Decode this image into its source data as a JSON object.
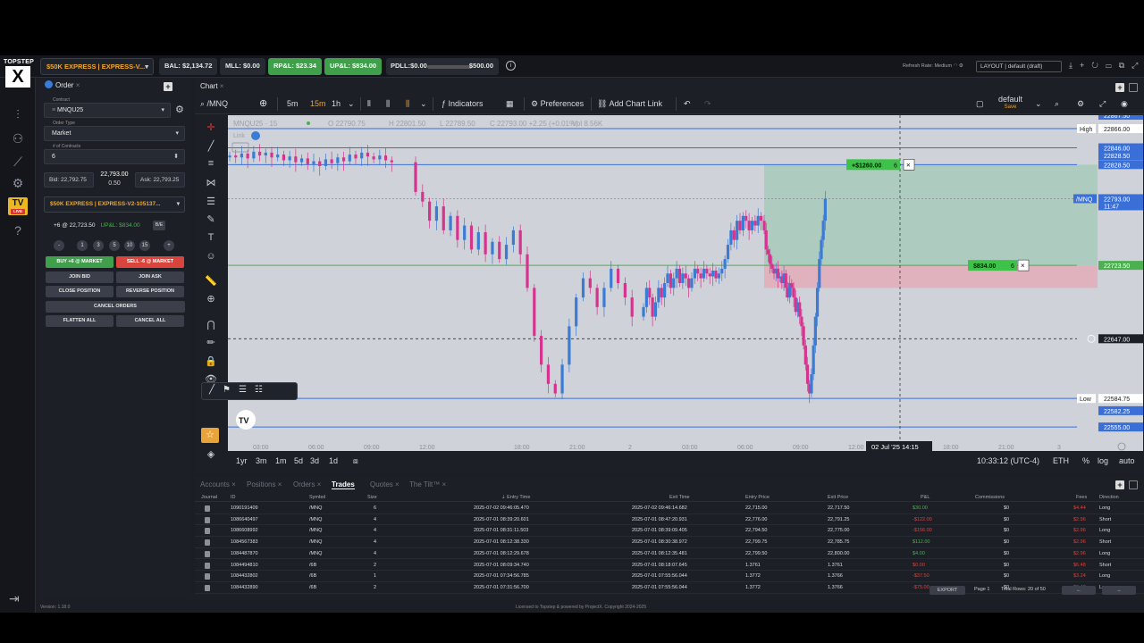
{
  "topbar": {
    "logo_top": "TOPSTEP",
    "logo_x": "X",
    "account": "$50K EXPRESS | EXPRESS-V...",
    "balance": "BAL: $2,134.72",
    "mll": "MLL: $0.00",
    "rpl": "RP&L: $23.34",
    "upl": "UP&L: $834.00",
    "pdll": "PDLL:$0.00",
    "pdll_max": "$500.00",
    "refresh_rate": "Refresh Rate: Medium",
    "layout": "LAYOUT | default (draft)"
  },
  "order_panel": {
    "tab_label": "Order",
    "contract_label": "Contract",
    "contract": "MNQU25",
    "order_type_label": "Order Type",
    "order_type": "Market",
    "contracts_label": "# of Contracts",
    "contracts": "6",
    "bid": "Bid: 22,792.75",
    "mid_price": "22,793.00",
    "spread": "0.50",
    "ask": "Ask: 22,793.25",
    "account": "$50K EXPRESS | EXPRESS-V2-105137...",
    "position": "+6 @ 22,723.50",
    "position_upl": "UP&L: $834.00",
    "be_label": "B/E",
    "qty_buttons": [
      "-",
      "1",
      "3",
      "5",
      "10",
      "15",
      "+"
    ],
    "buy_label": "BUY +6 @ MARKET",
    "sell_label": "SELL -6 @ MARKET",
    "join_bid": "JOIN BID",
    "join_ask": "JOIN ASK",
    "close_position": "CLOSE POSITION",
    "reverse_position": "REVERSE POSITION",
    "cancel_orders": "CANCEL ORDERS",
    "flatten_all": "FLATTEN ALL",
    "cancel_all": "CANCEL ALL"
  },
  "chart": {
    "tab_label": "Chart",
    "symbol": "/MNQ",
    "timeframes": [
      "5m",
      "15m",
      "1h"
    ],
    "active_timeframe": "15m",
    "indicators": "Indicators",
    "preferences": "Preferences",
    "add_chart_link": "Add Chart Link",
    "layout_name": "default",
    "layout_save": "Save",
    "legend_title": "MNQU25 · 15",
    "legend_o": "O 22790.75",
    "legend_h": "H 22801.50",
    "legend_l": "L 22789.50",
    "legend_c": "C 22793.00 +2.25 (+0.01%)",
    "legend_vol": "Vol 8.56K",
    "link_label": "Link",
    "tv_logo": "TV",
    "ranges": [
      "1yr",
      "3m",
      "1m",
      "5d",
      "3d",
      "1d"
    ],
    "clock": "10:33:12 (UTC-4)",
    "session": "ETH",
    "pct": "%",
    "log": "log",
    "auto": "auto",
    "crosshair_time": "02 Jul '25   14:15",
    "profit_tag": "+$1260.00",
    "profit_qty": "6",
    "position_tag": "$834.00",
    "position_qty": "6",
    "price_labels": {
      "p1": "22867.50",
      "high_tag": "High",
      "high": "22866.00",
      "p2": "22846.00",
      "p3": "22828.50",
      "p4": "22828.50",
      "last_symbol": "/MNQ",
      "last": "22793.00",
      "countdown": "11:47",
      "entry": "22723.50",
      "crosshair": "22647.00",
      "low_tag": "Low",
      "low": "22584.75",
      "p5": "22582.25",
      "p6": "22555.00"
    },
    "x_ticks": [
      "03:00",
      "06:00",
      "09:00",
      "12:00",
      "18:00",
      "21:00",
      "2",
      "03:00",
      "06:00",
      "09:00",
      "12:00",
      "18:00",
      "21:00",
      "3"
    ]
  },
  "chart_data": {
    "type": "candlestick",
    "symbol": "MNQU25",
    "interval": "15m",
    "ylim": [
      22530,
      22880
    ],
    "closes": [
      22838,
      22836,
      22840,
      22835,
      22842,
      22838,
      22841,
      22836,
      22839,
      22833,
      22837,
      22831,
      22835,
      22829,
      22832,
      22827,
      22834,
      22830,
      22836,
      22832,
      22839,
      22835,
      22841,
      22837,
      22834,
      22838,
      22833,
      22831,
      22800,
      22790,
      22770,
      22785,
      22760,
      22775,
      22750,
      22765,
      22740,
      22758,
      22735,
      22748,
      22730,
      22745,
      22760,
      22735,
      22700,
      22650,
      22620,
      22600,
      22590,
      22620,
      22660,
      22690,
      22710,
      22700,
      22680,
      22700,
      22720,
      22705,
      22690,
      22670,
      22680,
      22700,
      22690,
      22670,
      22685,
      22700,
      22690,
      22705,
      22715,
      22700,
      22710,
      22720,
      22705,
      22715,
      22710,
      22700,
      22710,
      22720,
      22715,
      22710,
      22720,
      22715,
      22712,
      22718,
      22710,
      22715,
      22720,
      22730,
      22745,
      22760,
      22750,
      22770,
      22760,
      22775,
      22770,
      22760,
      22770,
      22765,
      22775,
      22770,
      22760,
      22740,
      22735,
      22725,
      22720,
      22715,
      22720,
      22710,
      22712,
      22705,
      22715,
      22700,
      22690,
      22705,
      22700,
      22690,
      22675,
      22685,
      22670,
      22660,
      22640,
      22620,
      22600,
      22590,
      22610,
      22640,
      22670,
      22700,
      22730,
      22750,
      22770,
      22793
    ]
  },
  "trades_panel": {
    "tabs": [
      "Accounts",
      "Positions",
      "Orders",
      "Trades",
      "Quotes",
      "The Tilt™"
    ],
    "active_tab": "Trades",
    "columns": [
      "Journal",
      "ID",
      "Symbol",
      "Size",
      "Entry Time",
      "Exit Time",
      "Entry Price",
      "Exit Price",
      "P&L",
      "Commissions",
      "Fees",
      "Direction"
    ],
    "rows": [
      {
        "id": "1090191409",
        "symbol": "/MNQ",
        "size": "6",
        "entry_time": "2025-07-02 09:46:05.470",
        "exit_time": "2025-07-02 09:46:14.682",
        "entry_price": "22,715.00",
        "exit_price": "22,717.50",
        "pnl": "$30.00",
        "pnl_sign": "pos",
        "commissions": "$0",
        "fees": "$4.44",
        "direction": "Long"
      },
      {
        "id": "1086640497",
        "symbol": "/MNQ",
        "size": "4",
        "entry_time": "2025-07-01 08:39:20.601",
        "exit_time": "2025-07-01 08:47:20.931",
        "entry_price": "22,776.00",
        "exit_price": "22,791.25",
        "pnl": "-$122.00",
        "pnl_sign": "neg",
        "commissions": "$0",
        "fees": "$2.96",
        "direction": "Short"
      },
      {
        "id": "1086608992",
        "symbol": "/MNQ",
        "size": "4",
        "entry_time": "2025-07-01 08:31:11.503",
        "exit_time": "2025-07-01 08:39:09.405",
        "entry_price": "22,794.50",
        "exit_price": "22,775.00",
        "pnl": "-$156.00",
        "pnl_sign": "neg",
        "commissions": "$0",
        "fees": "$2.96",
        "direction": "Long"
      },
      {
        "id": "1084567383",
        "symbol": "/MNQ",
        "size": "4",
        "entry_time": "2025-07-01 08:12:38.330",
        "exit_time": "2025-07-01 08:30:38.972",
        "entry_price": "22,799.75",
        "exit_price": "22,785.75",
        "pnl": "$112.00",
        "pnl_sign": "pos",
        "commissions": "$0",
        "fees": "$2.96",
        "direction": "Short"
      },
      {
        "id": "1084487870",
        "symbol": "/MNQ",
        "size": "4",
        "entry_time": "2025-07-01 08:12:29.678",
        "exit_time": "2025-07-01 08:12:35.481",
        "entry_price": "22,799.50",
        "exit_price": "22,800.00",
        "pnl": "$4.00",
        "pnl_sign": "pos",
        "commissions": "$0",
        "fees": "$2.96",
        "direction": "Long"
      },
      {
        "id": "1084494810",
        "symbol": "/6B",
        "size": "2",
        "entry_time": "2025-07-01 08:09:34.740",
        "exit_time": "2025-07-01 08:18:07.645",
        "entry_price": "1.3761",
        "exit_price": "1.3761",
        "pnl": "$0.00",
        "pnl_sign": "neg",
        "commissions": "$0",
        "fees": "$6.48",
        "direction": "Short"
      },
      {
        "id": "1084432802",
        "symbol": "/6B",
        "size": "1",
        "entry_time": "2025-07-01 07:34:56.785",
        "exit_time": "2025-07-01 07:55:56.044",
        "entry_price": "1.3772",
        "exit_price": "1.3766",
        "pnl": "-$37.50",
        "pnl_sign": "neg",
        "commissions": "$0",
        "fees": "$3.24",
        "direction": "Long"
      },
      {
        "id": "1084432890",
        "symbol": "/6B",
        "size": "2",
        "entry_time": "2025-07-01 07:31:56.700",
        "exit_time": "2025-07-01 07:55:56.044",
        "entry_price": "1.3772",
        "exit_price": "1.3766",
        "pnl": "-$75.00",
        "pnl_sign": "neg",
        "commissions": "$0",
        "fees": "$6.48",
        "direction": "Long"
      }
    ],
    "export": "EXPORT",
    "page": "Page 1",
    "total_rows": "Total Rows: 20 of 50"
  },
  "status": {
    "version": "Version: 1.18.0",
    "license": "Licensed to Topstep & powered by ProjectX. Copyright 2024-2025"
  }
}
